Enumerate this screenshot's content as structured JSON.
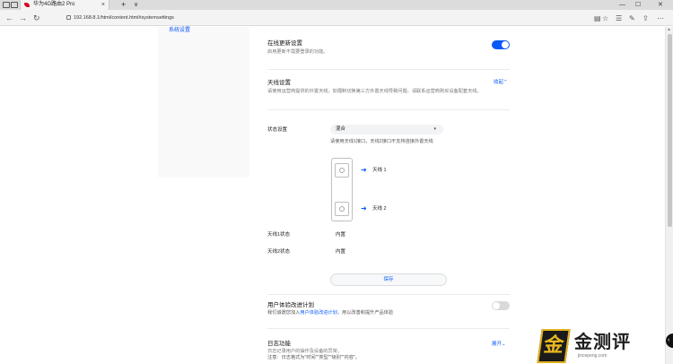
{
  "browser": {
    "tab_title": "华为4G路由2 Pro",
    "tab_close": "×",
    "new_tab": "+",
    "tab_menu": "∨",
    "win_min": "—",
    "win_max": "☐",
    "win_close": "✕",
    "back": "←",
    "forward": "→",
    "refresh": "↻",
    "url": "192.168.8.1/html/content.html#systemsettings",
    "reader": "▤",
    "favorite": "☆",
    "hub": "☰",
    "notes": "✎",
    "share": "⇪",
    "more": "⋯"
  },
  "sidebar": {
    "active_item": "系统设置"
  },
  "online_update": {
    "title": "在线更新设置",
    "desc": "启用更新不需要登录的功能。",
    "enabled": true
  },
  "antenna": {
    "title": "天线设置",
    "desc": "请使用运营商提供的外置天线，如强制切换第三方外置天线导致问题，请联系运营商购买设备配套天线。",
    "collapse_label": "收起",
    "collapse_icon": "⌃",
    "status_label": "状态设置",
    "status_value": "混合",
    "status_caret": "▾",
    "hint": "请使用天线1接口，天线2接口不支持连接外置天线",
    "antenna1_label": "天线 1",
    "antenna2_label": "天线 2",
    "arrow": "➜",
    "ant1_status_label": "天线1状态",
    "ant1_status_value": "内置",
    "ant2_status_label": "天线2状态",
    "ant2_status_value": "内置",
    "save_label": "保存"
  },
  "ux_program": {
    "title": "用户体验改进计划",
    "desc_prefix": "我们诚邀您加入",
    "desc_link": "用户体验改进计划",
    "desc_suffix": "，用以改善和提升产品体验",
    "enabled": false
  },
  "log": {
    "title": "日志功能",
    "desc": "日志记录用户的操作及设备的异常。",
    "note": "注意：日志格式为\"时间\"\"类型\"\"级别\"\"内容\"。",
    "expand_label": "展开",
    "expand_icon": "⌄"
  },
  "watermark": {
    "badge": "金",
    "text": "金测评",
    "sub": "jincepeng.com"
  },
  "fab_icon": "‹"
}
